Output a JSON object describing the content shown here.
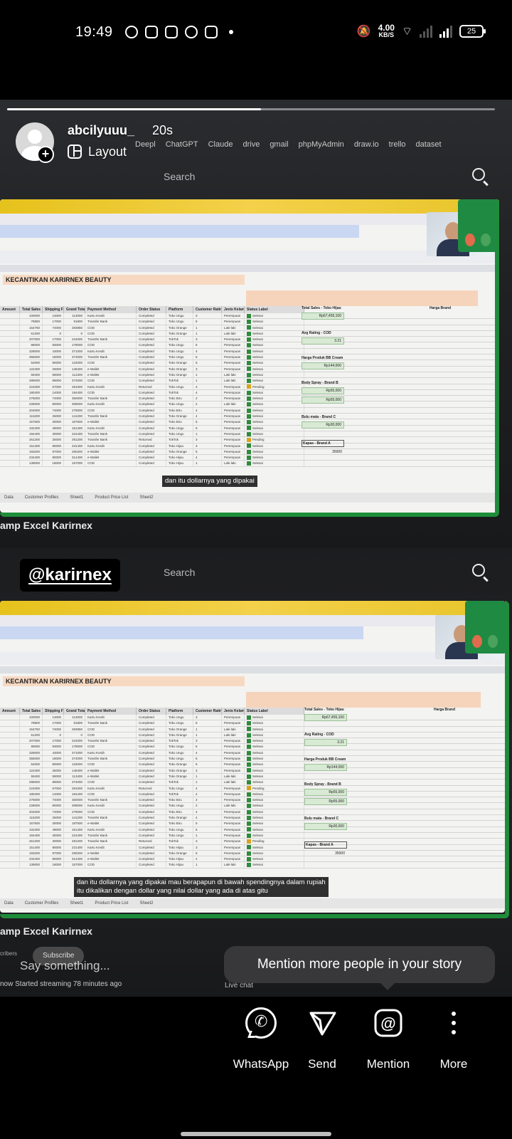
{
  "status_bar": {
    "time": "19:49",
    "net_speed": "4.00",
    "net_unit": "KB/S",
    "battery": "25"
  },
  "story": {
    "username": "abcilyuuu_",
    "time_ago": "20s",
    "layout_label": "Layout",
    "progress_fraction": 0.52,
    "mention_sticker": "@karirnex",
    "say_something_placeholder": "Say something...",
    "tooltip": "Mention more people in your story"
  },
  "media": {
    "browser_bookmarks": [
      "Deepl",
      "ChatGPT",
      "Claude",
      "drive",
      "gmail",
      "phpMyAdmin",
      "draw.io",
      "trello",
      "dataset"
    ],
    "search_label_top": "Search",
    "search_label_bottom": "Search",
    "sheet_title": "KECANTIKAN KARIRNEX BEAUTY",
    "sheet_headers": [
      "Amount",
      "Total Sales",
      "Shipping Fee",
      "Grand Total",
      "Payment Method",
      "Order Status",
      "Platform",
      "Customer Rating",
      "Jenis Kelamin",
      "Status Label"
    ],
    "side_panel": {
      "total_sales_label": "Total Sales - Toko Hijau",
      "total_sales_value": "Rp67,455,100",
      "avg_rating_label": "Avg Rating - COD",
      "avg_rating_value": "3.21",
      "harga_label": "Harga Produk BB Cream",
      "harga_value": "Rp144,000",
      "body_spray_label": "Body Spray - Brand B",
      "body_spray_value_1": "Rp55,000",
      "body_spray_value_2": "Rp55,000",
      "bulu_mata_label": "Bulu mata - Brand C",
      "bulu_mata_value": "Rp30,000",
      "kapas_label": "Kapas - Brand A",
      "kapas_value": "35000",
      "harga_brand_label": "Harga Brand"
    },
    "rows": [
      [
        "100000",
        "13000",
        "113000",
        "Kartu Kredit",
        "Completed",
        "Toko Ungu",
        "3",
        "Perempuan",
        "Selesai"
      ],
      [
        "78800",
        "17000",
        "91800",
        "Transfer Bank",
        "Completed",
        "Toko Ungu",
        "5",
        "Perempuan",
        "Selesai"
      ],
      [
        "154750",
        "74000",
        "293950",
        "COD",
        "Completed",
        "Toko Orange",
        "1",
        "Laki-laki",
        "Selesai"
      ],
      [
        "61200",
        "0",
        "0",
        "COD",
        "Completed",
        "Toko Orange",
        "1",
        "Laki-laki",
        "Selesai"
      ],
      [
        "207000",
        "17000",
        "224000",
        "Transfer Bank",
        "Completed",
        "TokTok",
        "3",
        "Perempuan",
        "Selesai"
      ],
      [
        "96000",
        "93000",
        "178000",
        "COD",
        "Completed",
        "Toko Ungu",
        "5",
        "Perempuan",
        "Selesai"
      ],
      [
        "328000",
        "43000",
        "371000",
        "Kartu Kredit",
        "Completed",
        "Toko Ungu",
        "4",
        "Perempuan",
        "Selesai"
      ],
      [
        "356000",
        "18000",
        "374000",
        "Transfer Bank",
        "Completed",
        "Toko Ungu",
        "5",
        "Perempuan",
        "Selesai"
      ],
      [
        "54000",
        "80000",
        "134000",
        "COD",
        "Completed",
        "Toko Orange",
        "5",
        "Perempuan",
        "Selesai"
      ],
      [
        "122400",
        "26000",
        "148400",
        "e-Wallet",
        "Completed",
        "Toko Orange",
        "3",
        "Perempuan",
        "Selesai"
      ],
      [
        "59400",
        "59000",
        "113400",
        "e-Wallet",
        "Completed",
        "Toko Orange",
        "1",
        "Laki-laki",
        "Selesai"
      ],
      [
        "285000",
        "89000",
        "374000",
        "COD",
        "Completed",
        "TokTok",
        "1",
        "Laki-laki",
        "Selesai"
      ],
      [
        "224000",
        "67000",
        "291000",
        "Kartu Kredit",
        "Returned",
        "Toko Ungu",
        "4",
        "Perempuan",
        "Pending"
      ],
      [
        "180400",
        "14000",
        "194400",
        "COD",
        "Completed",
        "TokTok",
        "4",
        "Perempuan",
        "Selesai"
      ],
      [
        "276000",
        "74000",
        "350000",
        "Transfer Bank",
        "Completed",
        "Toko Biru",
        "2",
        "Perempuan",
        "Selesai"
      ],
      [
        "228000",
        "80000",
        "308000",
        "Kartu Kredit",
        "Completed",
        "Toko Ungu",
        "2",
        "Laki-laki",
        "Selesai"
      ],
      [
        "204000",
        "74000",
        "278000",
        "COD",
        "Completed",
        "Toko Biru",
        "4",
        "Perempuan",
        "Selesai"
      ],
      [
        "115200",
        "26000",
        "141200",
        "Transfer Bank",
        "Completed",
        "Toko Orange",
        "4",
        "Perempuan",
        "Selesai"
      ],
      [
        "157500",
        "30000",
        "187500",
        "e-Wallet",
        "Completed",
        "Toko Biru",
        "5",
        "Perempuan",
        "Selesai"
      ],
      [
        "102400",
        "49000",
        "151400",
        "Kartu Kredit",
        "Completed",
        "Toko Ungu",
        "5",
        "Perempuan",
        "Selesai"
      ],
      [
        "194400",
        "30000",
        "224400",
        "Transfer Bank",
        "Completed",
        "Toko Ungu",
        "1",
        "Perempuan",
        "Selesai"
      ],
      [
        "261200",
        "30000",
        "291200",
        "Transfer Bank",
        "Returned",
        "TokTok",
        "3",
        "Perempuan",
        "Pending"
      ],
      [
        "151400",
        "80000",
        "231400",
        "Kartu Kredit",
        "Completed",
        "Toko Hijau",
        "3",
        "Perempuan",
        "Selesai"
      ],
      [
        "193200",
        "97000",
        "290200",
        "e-Wallet",
        "Completed",
        "Toko Orange",
        "5",
        "Perempuan",
        "Selesai"
      ],
      [
        "234400",
        "80000",
        "314400",
        "e-Wallet",
        "Completed",
        "Toko Hijau",
        "4",
        "Perempuan",
        "Selesai"
      ],
      [
        "139000",
        "18000",
        "157000",
        "COD",
        "Completed",
        "Toko Hijau",
        "1",
        "Laki-laki",
        "Selesai"
      ]
    ],
    "sheet_tabs": [
      "Data",
      "Customer Profiles",
      "Sheet1",
      "Product Price List",
      "Sheet2"
    ],
    "caption_top": "dan itu dollarnya yang dipakai",
    "caption_bottom_1": "dan itu dollarnya yang dipakai mau berapapun di bawah spendingnya dalam rupiah",
    "caption_bottom_2": "itu dikalikan dengan dollar yang nilai dollar yang ada di atas gitu",
    "video_title": "amp Excel Karirnex",
    "subscribe": "Subscribe",
    "subscribers": "cribers",
    "streaming": "now  Started streaming 78 minutes ago",
    "live_chat": "Live chat"
  },
  "actions": [
    {
      "label": "WhatsApp",
      "icon": "whatsapp-icon"
    },
    {
      "label": "Send",
      "icon": "send-icon"
    },
    {
      "label": "Mention",
      "icon": "mention-icon"
    },
    {
      "label": "More",
      "icon": "more-icon"
    }
  ]
}
